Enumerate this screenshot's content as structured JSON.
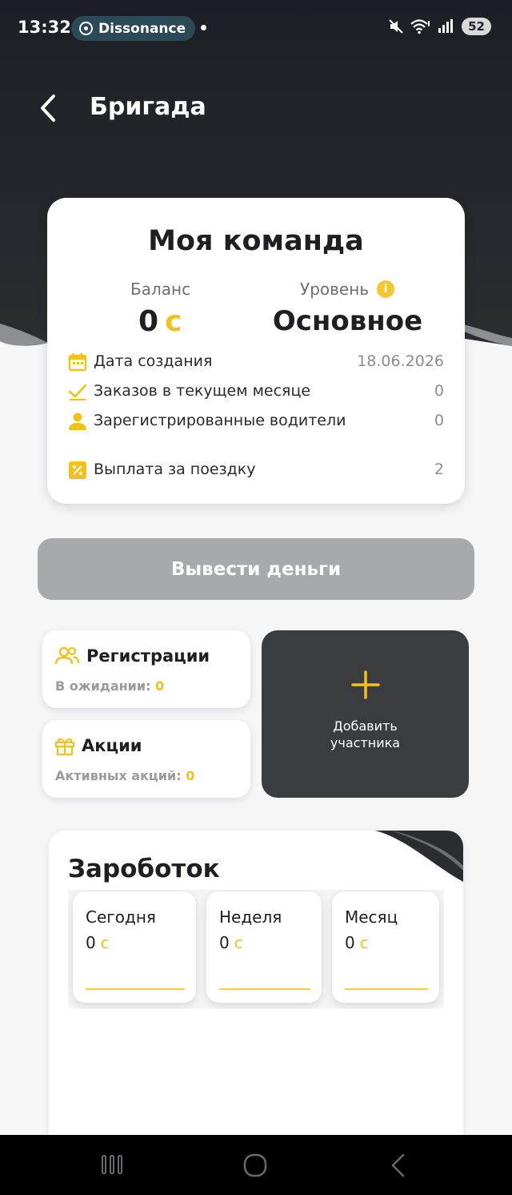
{
  "status_bar": {
    "time": "13:32",
    "notification_app": "Dissonance",
    "battery": "52"
  },
  "header": {
    "title": "Бригада"
  },
  "team": {
    "title": "Моя команда",
    "balance_label": "Баланс",
    "balance_value": "0",
    "currency": "с",
    "level_label": "Уровень",
    "level_value": "Основное",
    "stats": [
      {
        "icon": "calendar-icon",
        "label": "Дата создания",
        "value": "18.06.2026"
      },
      {
        "icon": "checkmark-icon",
        "label": "Заказов в текущем месяце",
        "value": "0"
      },
      {
        "icon": "person-icon",
        "label": "Зарегистрированные водители",
        "value": "0"
      },
      {
        "icon": "percent-icon",
        "label": "Выплата за поездку",
        "value": "2"
      }
    ]
  },
  "withdraw": {
    "label": "Вывести деньги"
  },
  "registrations": {
    "title": "Регистрации",
    "sub_label": "В ожидании:",
    "sub_value": "0"
  },
  "promotions": {
    "title": "Акции",
    "sub_label": "Активных акций:",
    "sub_value": "0"
  },
  "add_member": {
    "line1": "Добавить",
    "line2": "участника"
  },
  "earnings": {
    "title": "Зароботок",
    "periods": [
      {
        "name": "Сегодня",
        "value": "0",
        "currency": "с"
      },
      {
        "name": "Неделя",
        "value": "0",
        "currency": "с"
      },
      {
        "name": "Месяц",
        "value": "0",
        "currency": "с"
      }
    ]
  },
  "colors": {
    "accent": "#f2c21b",
    "dark": "#22252b",
    "button_disabled": "#a8a9ad"
  }
}
